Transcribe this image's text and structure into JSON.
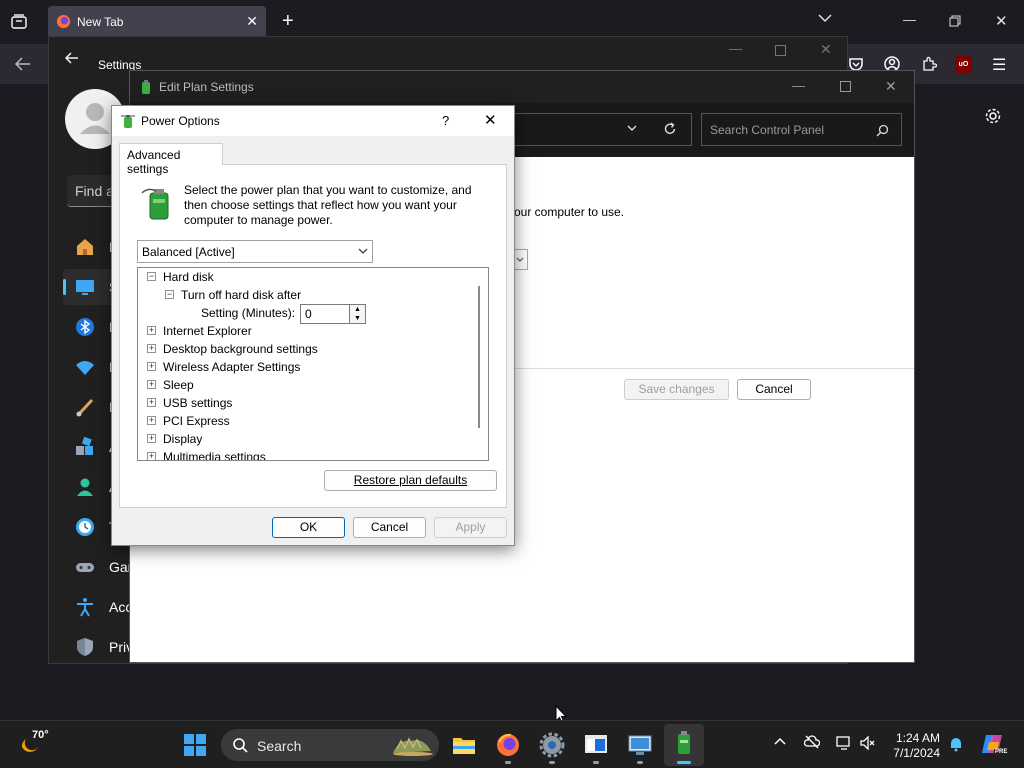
{
  "browser": {
    "tab_title": "New Tab",
    "new_tab_symbol": "+",
    "accent": "#1c1b22"
  },
  "settings": {
    "title": "Settings",
    "search_placeholder": "Find a",
    "nav": [
      {
        "label": "H",
        "icon": "home-icon"
      },
      {
        "label": "S",
        "icon": "system-icon"
      },
      {
        "label": "B",
        "icon": "bluetooth-icon"
      },
      {
        "label": "N",
        "icon": "network-icon"
      },
      {
        "label": "P",
        "icon": "brush-icon"
      },
      {
        "label": "A",
        "icon": "apps-icon"
      },
      {
        "label": "A",
        "icon": "accounts-icon"
      },
      {
        "label": "T",
        "icon": "time-icon"
      },
      {
        "label": "Gar",
        "icon": "gaming-icon"
      },
      {
        "label": "Acc",
        "icon": "accessibility-icon"
      },
      {
        "label": "Priv",
        "icon": "privacy-icon"
      }
    ]
  },
  "edit_plan": {
    "title": "Edit Plan Settings",
    "search_placeholder": "Search Control Panel",
    "partial_text": "our computer to use.",
    "save_label": "Save changes",
    "cancel_label": "Cancel"
  },
  "power_options": {
    "title": "Power Options",
    "help_symbol": "?",
    "tab_label": "Advanced settings",
    "description": "Select the power plan that you want to customize, and then choose settings that reflect how you want your computer to manage power.",
    "plan_selected": "Balanced [Active]",
    "tree": [
      {
        "label": "Hard disk",
        "expander": "−"
      },
      {
        "label": "Turn off hard disk after",
        "expander": "−"
      },
      {
        "label": "Setting (Minutes):"
      },
      {
        "label": "Internet Explorer",
        "expander": "+"
      },
      {
        "label": "Desktop background settings",
        "expander": "+"
      },
      {
        "label": "Wireless Adapter Settings",
        "expander": "+"
      },
      {
        "label": "Sleep",
        "expander": "+"
      },
      {
        "label": "USB settings",
        "expander": "+"
      },
      {
        "label": "PCI Express",
        "expander": "+"
      },
      {
        "label": "Display",
        "expander": "+"
      },
      {
        "label": "Multimedia settings",
        "expander": "+"
      }
    ],
    "minutes_value": "0",
    "restore_label": "Restore plan defaults",
    "ok_label": "OK",
    "cancel_label": "Cancel",
    "apply_label": "Apply"
  },
  "taskbar": {
    "weather_temp": "70°",
    "search_label": "Search",
    "time": "1:24 AM",
    "date": "7/1/2024",
    "copilot_badge": "PRE"
  }
}
